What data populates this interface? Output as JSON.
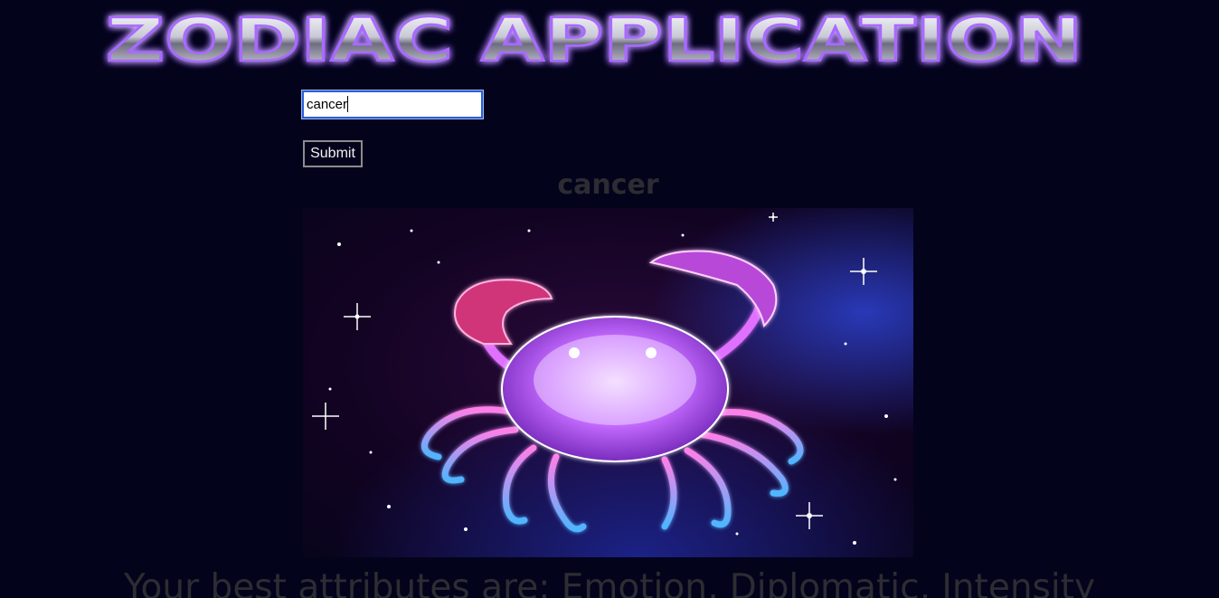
{
  "header": {
    "title": "ZODIAC APPLICATION"
  },
  "search": {
    "value": "cancer",
    "submit_label": "Submit"
  },
  "result": {
    "sign_name": "cancer",
    "image_subject": "crab-constellation",
    "attributes_text": "Your best attributes are: Emotion, Diplomatic, Intensity"
  },
  "colors": {
    "background": "#03031c",
    "title_glow": "#8a3cff",
    "muted_text": "#2c2c32"
  }
}
